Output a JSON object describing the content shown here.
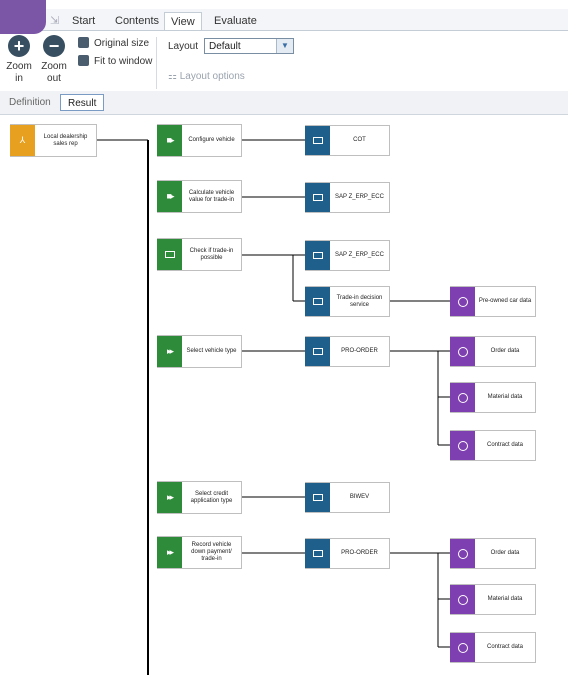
{
  "ribbon": {
    "tabs": [
      "Start",
      "Contents",
      "View",
      "Evaluate"
    ],
    "active_tab": "View",
    "zoom_in": "Zoom in",
    "zoom_out": "Zoom out",
    "original_size": "Original size",
    "fit_to_window": "Fit to window",
    "layout_label": "Layout",
    "layout_value": "Default",
    "layout_options": "Layout options"
  },
  "view_tabs": [
    "Definition",
    "Result"
  ],
  "active_view_tab": "Result",
  "diagram": {
    "role": "Local dealership sales rep",
    "functions": [
      "Configure vehicle",
      "Calculate vehicle value for trade-in",
      "Check if trade-in possible",
      "Select vehicle type",
      "Select credit application type",
      "Record vehicle down payment/ trade-in"
    ],
    "systems": [
      "COT",
      "SAP Z_ERP_ECC",
      "SAP Z_ERP_ECC",
      "Trade-in decision service",
      "PRO-ORDER",
      "BIWEV",
      "PRO-ORDER"
    ],
    "data": [
      "Pre-owned car data",
      "Order data",
      "Material data",
      "Contract data",
      "Order data",
      "Material data",
      "Contract data"
    ]
  },
  "colors": {
    "role": "#e8a020",
    "function": "#2e8b3a",
    "system": "#1f5f8b",
    "data": "#7e3fb0",
    "logo": "#7b55a6"
  }
}
